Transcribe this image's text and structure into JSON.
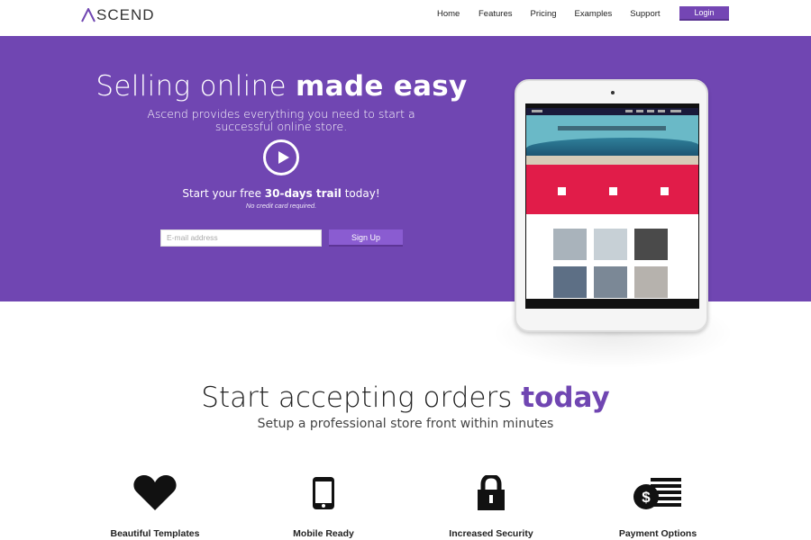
{
  "header": {
    "logo_text": "SCEND",
    "nav": [
      "Home",
      "Features",
      "Pricing",
      "Examples",
      "Support"
    ],
    "login_label": "Login"
  },
  "hero": {
    "title_light": "Selling online ",
    "title_bold": "made easy",
    "subtitle": "Ascend provides everything you need to start a successful online store.",
    "trial_prefix": "Start your free ",
    "trial_bold": "30-days trail",
    "trial_suffix": " today!",
    "no_cc": "No credit card required.",
    "email_placeholder": "E-mail address",
    "signup_label": "Sign Up"
  },
  "section2": {
    "title_light": "Start accepting orders ",
    "title_bold": "today",
    "subtitle": "Setup a professional store front within minutes"
  },
  "features": [
    {
      "label": "Beautiful Templates",
      "icon": "heart-icon"
    },
    {
      "label": "Mobile Ready",
      "icon": "mobile-icon"
    },
    {
      "label": "Increased Security",
      "icon": "lock-icon"
    },
    {
      "label": "Payment Options",
      "icon": "payment-icon"
    }
  ],
  "colors": {
    "brand": "#7046b2",
    "button": "#7446b4"
  }
}
